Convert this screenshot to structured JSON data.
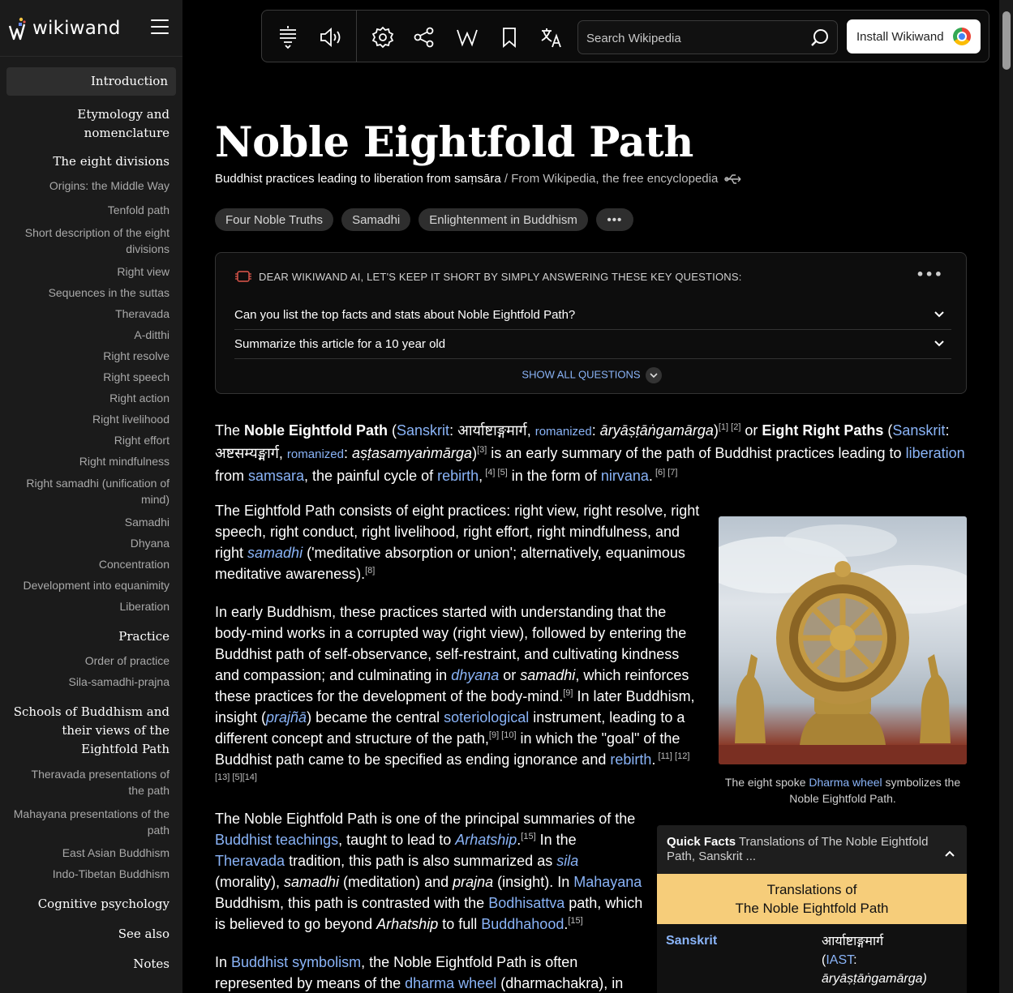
{
  "sidebar": {
    "logo_text": "wikiwand",
    "toc": [
      {
        "label": "Introduction",
        "level": "h"
      },
      {
        "label": "Etymology and nomenclature",
        "level": "h"
      },
      {
        "label": "The eight divisions",
        "level": "h"
      },
      {
        "label": "Origins: the Middle Way",
        "level": "s"
      },
      {
        "label": "Tenfold path",
        "level": "s"
      },
      {
        "label": "Short description of the eight divisions",
        "level": "s"
      },
      {
        "label": "Right view",
        "level": "s"
      },
      {
        "label": "Sequences in the suttas",
        "level": "s"
      },
      {
        "label": "Theravada",
        "level": "s"
      },
      {
        "label": "A-ditthi",
        "level": "s"
      },
      {
        "label": "Right resolve",
        "level": "s"
      },
      {
        "label": "Right speech",
        "level": "s"
      },
      {
        "label": "Right action",
        "level": "s"
      },
      {
        "label": "Right livelihood",
        "level": "s"
      },
      {
        "label": "Right effort",
        "level": "s"
      },
      {
        "label": "Right mindfulness",
        "level": "s"
      },
      {
        "label": "Right samadhi (unification of mind)",
        "level": "s"
      },
      {
        "label": "Samadhi",
        "level": "s"
      },
      {
        "label": "Dhyana",
        "level": "s"
      },
      {
        "label": "Concentration",
        "level": "s"
      },
      {
        "label": "Development into equanimity",
        "level": "s"
      },
      {
        "label": "Liberation",
        "level": "s"
      },
      {
        "label": "Practice",
        "level": "h"
      },
      {
        "label": "Order of practice",
        "level": "s"
      },
      {
        "label": "Sila-samadhi-prajna",
        "level": "s"
      },
      {
        "label": "Schools of Buddhism and their views of the Eightfold Path",
        "level": "h"
      },
      {
        "label": "Theravada presentations of the path",
        "level": "s"
      },
      {
        "label": "Mahayana presentations of the path",
        "level": "s"
      },
      {
        "label": "East Asian Buddhism",
        "level": "s"
      },
      {
        "label": "Indo-Tibetan Buddhism",
        "level": "s"
      },
      {
        "label": "Cognitive psychology",
        "level": "h"
      },
      {
        "label": "See also",
        "level": "h"
      },
      {
        "label": "Notes",
        "level": "h"
      }
    ]
  },
  "toolbar": {
    "search_placeholder": "Search Wikipedia",
    "install_label": "Install Wikiwand",
    "icons": [
      "text-size-icon",
      "speaker-icon",
      "settings-icon",
      "share-icon",
      "wikipedia-icon",
      "bookmark-icon",
      "translate-icon"
    ]
  },
  "article": {
    "title": "Noble Eightfold Path",
    "subtitle_desc": "Buddhist practices leading to liberation from saṃsāra",
    "subtitle_from": " / From Wikipedia, the free encyclopedia",
    "chips": [
      "Four Noble Truths",
      "Samadhi",
      "Enlightenment in Buddhism",
      "•••"
    ]
  },
  "ai_box": {
    "heading": "DEAR WIKIWAND AI, LET'S KEEP IT SHORT BY SIMPLY ANSWERING THESE KEY QUESTIONS:",
    "menu": "•••",
    "questions": [
      "Can you list the top facts and stats about Noble Eightfold Path?",
      "Summarize this article for a 10 year old"
    ],
    "show_all": "SHOW ALL QUESTIONS"
  },
  "figure": {
    "caption_pre": "The eight spoke ",
    "caption_link": "Dharma wheel",
    "caption_post": " symbolizes the Noble Eightfold Path."
  },
  "quick_facts": {
    "label": "Quick Facts",
    "summary": " Translations of The Noble Eightfold Path, Sanskrit ...",
    "band_line1": "Translations of",
    "band_line2": "The Noble Eightfold Path",
    "row_key": "Sanskrit",
    "row_val_line1": "आर्याष्टाङ्गमार्ग",
    "row_val_paren_open": "(",
    "row_val_link": "IAST",
    "row_val_paren_close": ":",
    "row_val_line3": "āryāṣṭāṅgamārga)"
  },
  "colors": {
    "background": "#000000",
    "sidebar": "#1b1b1b",
    "link": "#8ab4f8",
    "quickfacts_band": "#f6cd7a"
  }
}
